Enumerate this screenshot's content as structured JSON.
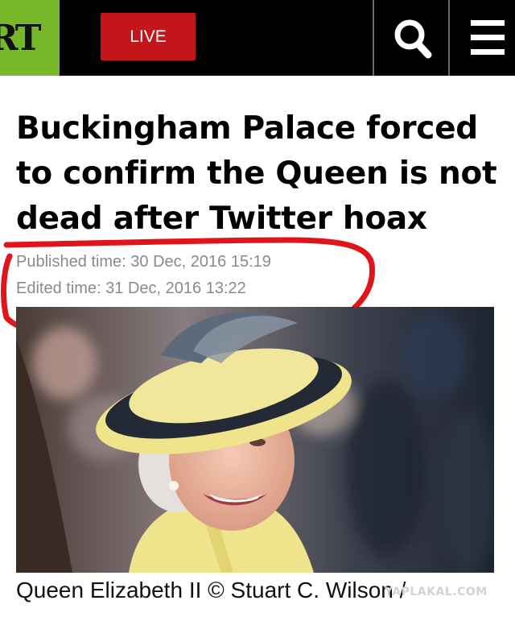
{
  "header": {
    "logo_text": "RT",
    "live_label": "LIVE",
    "search_icon": "search-icon",
    "menu_icon": "hamburger-menu-icon",
    "colors": {
      "logo_bg": "#76b82a",
      "live_bg": "#c2161a",
      "header_bg": "#000000"
    }
  },
  "article": {
    "title": "Buckingham Palace forced to confirm the Queen is not dead after Twitter hoax",
    "published": "Published time: 30 Dec, 2016 15:19",
    "edited": "Edited time: 31 Dec, 2016 13:22",
    "caption": "Queen Elizabeth II © Stuart C. Wilson /",
    "annotation_color": "#e0151b"
  },
  "watermark": "YAPLAKAL.COM"
}
